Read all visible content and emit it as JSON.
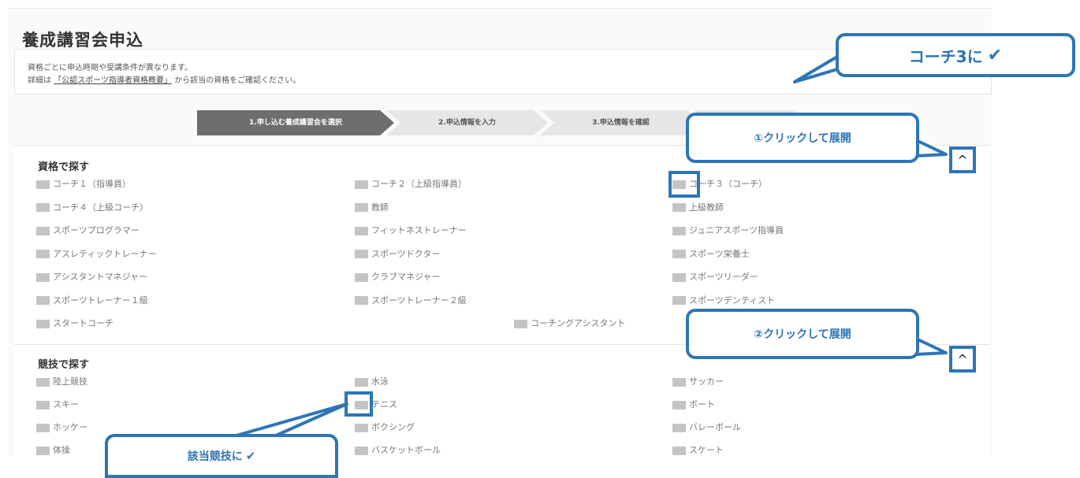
{
  "page": {
    "title": "養成講習会申込"
  },
  "notice": {
    "line1": "資格ごとに申込時期や受講条件が異なります。",
    "line2_prefix": "詳細は",
    "line2_link": "「公認スポーツ指導者資格概要」",
    "line2_suffix": "から該当の資格をご確認ください。"
  },
  "steps": [
    "1.申し込む養成講習会を選択",
    "2.申込情報を入力",
    "3.申込情報を確認"
  ],
  "qualifications": {
    "title": "資格で探す",
    "items": [
      "コーチ１（指導員）",
      "コーチ２（上級指導員）",
      "コーチ３（コーチ）",
      "コーチ４（上級コーチ）",
      "教師",
      "上級教師",
      "スポーツプログラマー",
      "フィットネストレーナー",
      "ジュニアスポーツ指導員",
      "アスレティックトレーナー",
      "スポーツドクター",
      "スポーツ栄養士",
      "アシスタントマネジャー",
      "クラブマネジャー",
      "スポーツリーダー",
      "スポーツトレーナー１級",
      "スポーツトレーナー２級",
      "スポーツデンティスト",
      "スタートコーチ",
      "コーチングアシスタント"
    ]
  },
  "sports": {
    "title": "競技で探す",
    "items": [
      "陸上競技",
      "水泳",
      "サッカー",
      "スキー",
      "テニス",
      "ボート",
      "ホッケー",
      "ボクシング",
      "バレーボール",
      "体操",
      "バスケットボール",
      "スケート"
    ]
  },
  "toggle_icon": "^",
  "callouts": {
    "coach3": "コーチ3に",
    "expand1": "①クリックして展開",
    "expand2": "②クリックして展開",
    "sport": "該当競技に",
    "check": "✔"
  },
  "accent_color": "#2e75b6"
}
